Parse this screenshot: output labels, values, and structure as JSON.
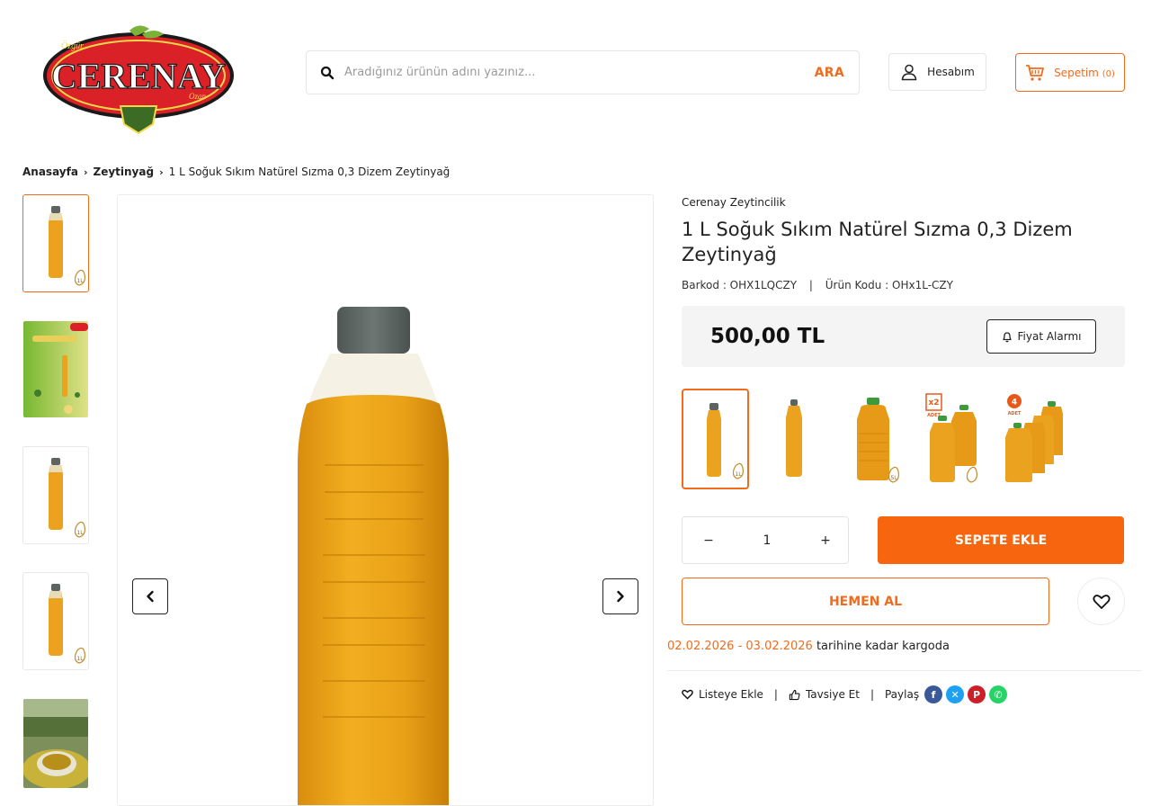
{
  "header": {
    "logo": {
      "small_text": "Özgür",
      "brand": "CERENAY",
      "sub_text": "Ozan"
    },
    "search": {
      "placeholder": "Aradığınız ürünün adını yazınız...",
      "button_label": "ARA"
    },
    "account_label": "Hesabım",
    "cart_label": "Sepetim",
    "cart_count": "(0)"
  },
  "breadcrumb": [
    "Anasayfa",
    "Zeytinyağ",
    "1 L Soğuk Sıkım Natürel Sızma 0,3 Dizem Zeytinyağ"
  ],
  "gallery": {
    "thumbnails": [
      "bottle-1l",
      "infographic",
      "bottle-1l",
      "bottle-1l",
      "serving-photo"
    ],
    "active_index": 0
  },
  "product": {
    "brand": "Cerenay Zeytincilik",
    "title": "1 L Soğuk Sıkım Natürel Sızma 0,3 Dizem Zeytinyağ",
    "barcode": "Barkod : OHX1LQCZY",
    "product_code": "Ürün Kodu : OHx1L-CZY",
    "price": "500,00 TL",
    "price_alarm_label": "Fiyat Alarmı",
    "variants": [
      "1 L şişe",
      "0,5 L şişe",
      "5 L bidon",
      "2 adet 5 L bidon",
      "4 adet 5 L bidon"
    ],
    "variant_labels": {
      "variant_4": "x2",
      "variant_4_sub": "ADET",
      "variant_5": "4",
      "variant_5_sub": "ADET"
    },
    "quantity": "1",
    "minus": "−",
    "plus": "+",
    "add_to_cart_label": "SEPETE EKLE",
    "buy_now_label": "HEMEN AL",
    "shipping_dates": "02.02.2026 - 03.02.2026",
    "shipping_text": " tarihine kadar kargoda"
  },
  "actions": {
    "wishlist_label": "Listeye Ekle",
    "recommend_label": "Tavsiye Et",
    "share_label": "Paylaş"
  },
  "colors": {
    "accent": "#f26b1d",
    "facebook": "#3b5998",
    "x": "#1da1f2",
    "pinterest": "#cb2027",
    "whatsapp": "#25d366"
  }
}
